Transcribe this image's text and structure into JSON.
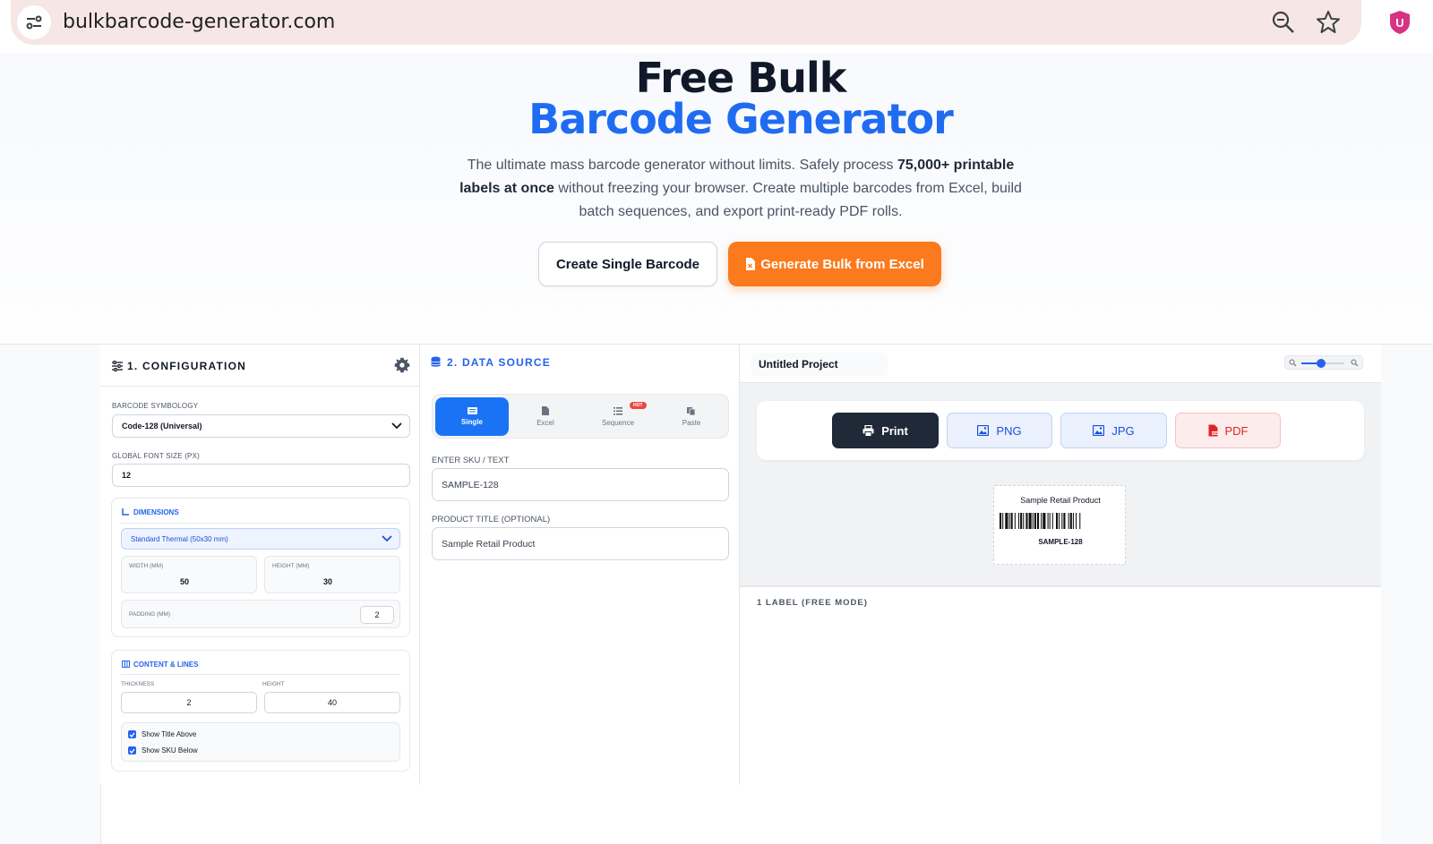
{
  "browser": {
    "url": "bulkbarcode-generator.com"
  },
  "hero": {
    "title_line1": "Free Bulk",
    "title_line2": "Barcode Generator",
    "desc_part1": "The ultimate mass barcode generator without limits. Safely process ",
    "desc_bold1": "75,000+ printable labels at once",
    "desc_part2": " without freezing your browser. Create multiple barcodes from Excel, build batch sequences, and export print-ready PDF rolls.",
    "btn_single": "Create Single Barcode",
    "btn_bulk": "Generate Bulk from Excel"
  },
  "config": {
    "title": "1. CONFIGURATION",
    "symbology_label": "BARCODE SYMBOLOGY",
    "symbology_value": "Code-128 (Universal)",
    "font_size_label": "GLOBAL FONT SIZE (PX)",
    "font_size_value": "12",
    "dimensions": {
      "title": "DIMENSIONS",
      "preset": "Standard Thermal (50x30 mm)",
      "width_label": "WIDTH (MM)",
      "width_value": "50",
      "height_label": "HEIGHT (MM)",
      "height_value": "30",
      "padding_label": "PADDING (MM)",
      "padding_value": "2"
    },
    "content": {
      "title": "CONTENT & LINES",
      "thickness_label": "THICKNESS",
      "thickness_value": "2",
      "height_label": "HEIGHT",
      "height_value": "40",
      "show_title_label": "Show Title Above",
      "show_sku_label": "Show SKU Below",
      "show_title": true,
      "show_sku": true
    }
  },
  "datasource": {
    "title": "2. DATA SOURCE",
    "tabs": [
      {
        "label": "Single",
        "active": true
      },
      {
        "label": "Excel",
        "active": false
      },
      {
        "label": "Sequence",
        "active": false,
        "badge": "HOT"
      },
      {
        "label": "Paste",
        "active": false
      }
    ],
    "sku_label": "ENTER SKU / TEXT",
    "sku_value": "SAMPLE-128",
    "product_label": "PRODUCT TITLE (OPTIONAL)",
    "product_value": "Sample Retail Product"
  },
  "preview": {
    "project_name": "Untitled Project",
    "zoom_level": 0.45,
    "buttons": {
      "print": "Print",
      "png": "PNG",
      "jpg": "JPG",
      "pdf": "PDF"
    },
    "label": {
      "title": "Sample Retail Product",
      "sku": "SAMPLE-128"
    },
    "count_text": "1 LABEL (FREE MODE)"
  },
  "colors": {
    "accent_blue": "#1f6cf2",
    "accent_orange": "#fb7a1e",
    "print_dark": "#1f2937",
    "pdf_red": "#dc2626"
  },
  "icons": [
    "site-info-icon",
    "zoom-icon",
    "star-icon",
    "extension-icon",
    "sliders-icon",
    "gear-icon",
    "database-icon",
    "file-excel-icon",
    "list-icon",
    "clipboard-icon",
    "printer-icon",
    "image-icon",
    "pdf-icon",
    "ruler-icon",
    "columns-icon"
  ]
}
